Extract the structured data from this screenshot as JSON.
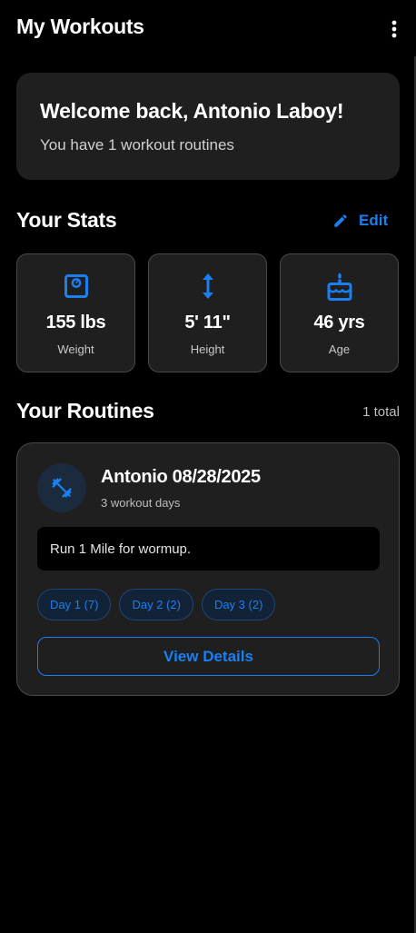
{
  "appbar": {
    "title": "My Workouts",
    "menu_icon": "more-vertical-icon"
  },
  "welcome": {
    "title": "Welcome back, Antonio Laboy!",
    "subtitle": "You have 1 workout routines"
  },
  "stats": {
    "title": "Your Stats",
    "edit_label": "Edit",
    "edit_icon": "pencil-icon",
    "items": [
      {
        "icon": "scale-icon",
        "value": "155 lbs",
        "label": "Weight"
      },
      {
        "icon": "height-arrows-icon",
        "value": "5' 11\"",
        "label": "Height"
      },
      {
        "icon": "cake-icon",
        "value": "46 yrs",
        "label": "Age"
      }
    ]
  },
  "routines": {
    "title": "Your Routines",
    "count_label": "1 total",
    "items": [
      {
        "icon": "dumbbell-icon",
        "name": "Antonio 08/28/2025",
        "days_label": "3 workout days",
        "notes": "Run 1 Mile for wormup.",
        "day_chips": [
          "Day 1 (7)",
          "Day 2 (2)",
          "Day 3 (2)"
        ],
        "view_label": "View Details"
      }
    ]
  },
  "colors": {
    "background": "#000000",
    "card": "#1f1f1f",
    "accent": "#1a7ff0",
    "chip_bg": "#132337"
  }
}
